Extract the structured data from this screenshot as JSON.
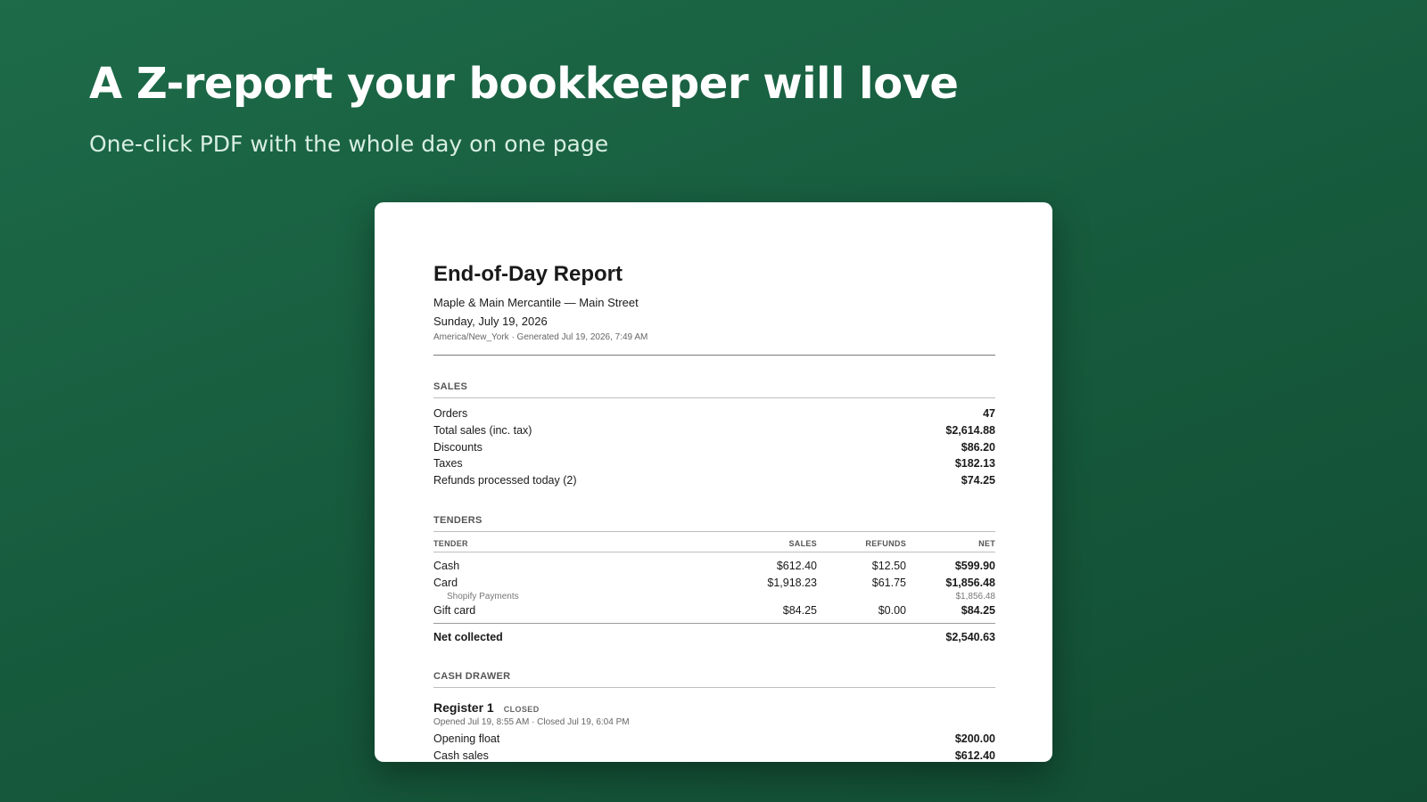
{
  "hero": {
    "title": "A Z-report your bookkeeper will love",
    "subtitle": "One-click PDF with the whole day on one page"
  },
  "report": {
    "title": "End-of-Day Report",
    "store": "Maple & Main Mercantile — Main Street",
    "date": "Sunday, July 19, 2026",
    "meta": "America/New_York · Generated Jul 19, 2026, 7:49 AM",
    "sales": {
      "label": "SALES",
      "rows": [
        {
          "label": "Orders",
          "value": "47"
        },
        {
          "label": "Total sales (inc. tax)",
          "value": "$2,614.88"
        },
        {
          "label": "Discounts",
          "value": "$86.20"
        },
        {
          "label": "Taxes",
          "value": "$182.13"
        },
        {
          "label": "Refunds processed today (2)",
          "value": "$74.25"
        }
      ]
    },
    "tenders": {
      "label": "TENDERS",
      "columns": {
        "tender": "TENDER",
        "sales": "SALES",
        "refunds": "REFUNDS",
        "net": "NET"
      },
      "rows": [
        {
          "tender": "Cash",
          "sales": "$612.40",
          "refunds": "$12.50",
          "net": "$599.90"
        },
        {
          "tender": "Card",
          "sales": "$1,918.23",
          "refunds": "$61.75",
          "net": "$1,856.48"
        },
        {
          "tender": "Gift card",
          "sales": "$84.25",
          "refunds": "$0.00",
          "net": "$84.25"
        }
      ],
      "card_sub": {
        "label": "Shopify Payments",
        "value": "$1,856.48"
      },
      "net_collected": {
        "label": "Net collected",
        "value": "$2,540.63"
      }
    },
    "cash_drawer": {
      "label": "CASH DRAWER",
      "register": {
        "name": "Register 1",
        "status": "CLOSED",
        "meta": "Opened Jul 19, 8:55 AM · Closed Jul 19, 6:04 PM"
      },
      "rows": [
        {
          "label": "Opening float",
          "value": "$200.00"
        },
        {
          "label": "Cash sales",
          "value": "$612.40"
        }
      ]
    }
  }
}
